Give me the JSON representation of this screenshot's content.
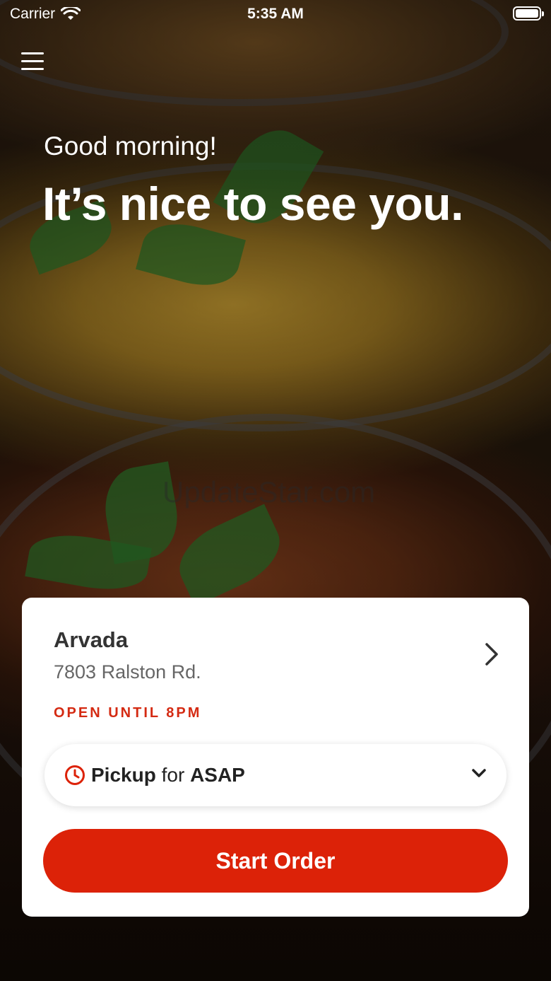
{
  "status_bar": {
    "carrier": "Carrier",
    "time": "5:35 AM"
  },
  "header": {
    "greeting": "Good morning!",
    "headline": "It’s nice to see you."
  },
  "watermark": "UpdateStar.com",
  "location": {
    "name": "Arvada",
    "address": "7803 Ralston Rd.",
    "hours": "OPEN UNTIL 8PM"
  },
  "order_mode": {
    "mode": "Pickup",
    "connector": "for",
    "time": "ASAP"
  },
  "actions": {
    "start_label": "Start Order"
  },
  "colors": {
    "accent": "#dc2208",
    "status_red": "#d42a12"
  },
  "icons": [
    "wifi-icon",
    "battery-icon",
    "menu-icon",
    "chevron-right-icon",
    "clock-icon",
    "chevron-down-icon"
  ]
}
